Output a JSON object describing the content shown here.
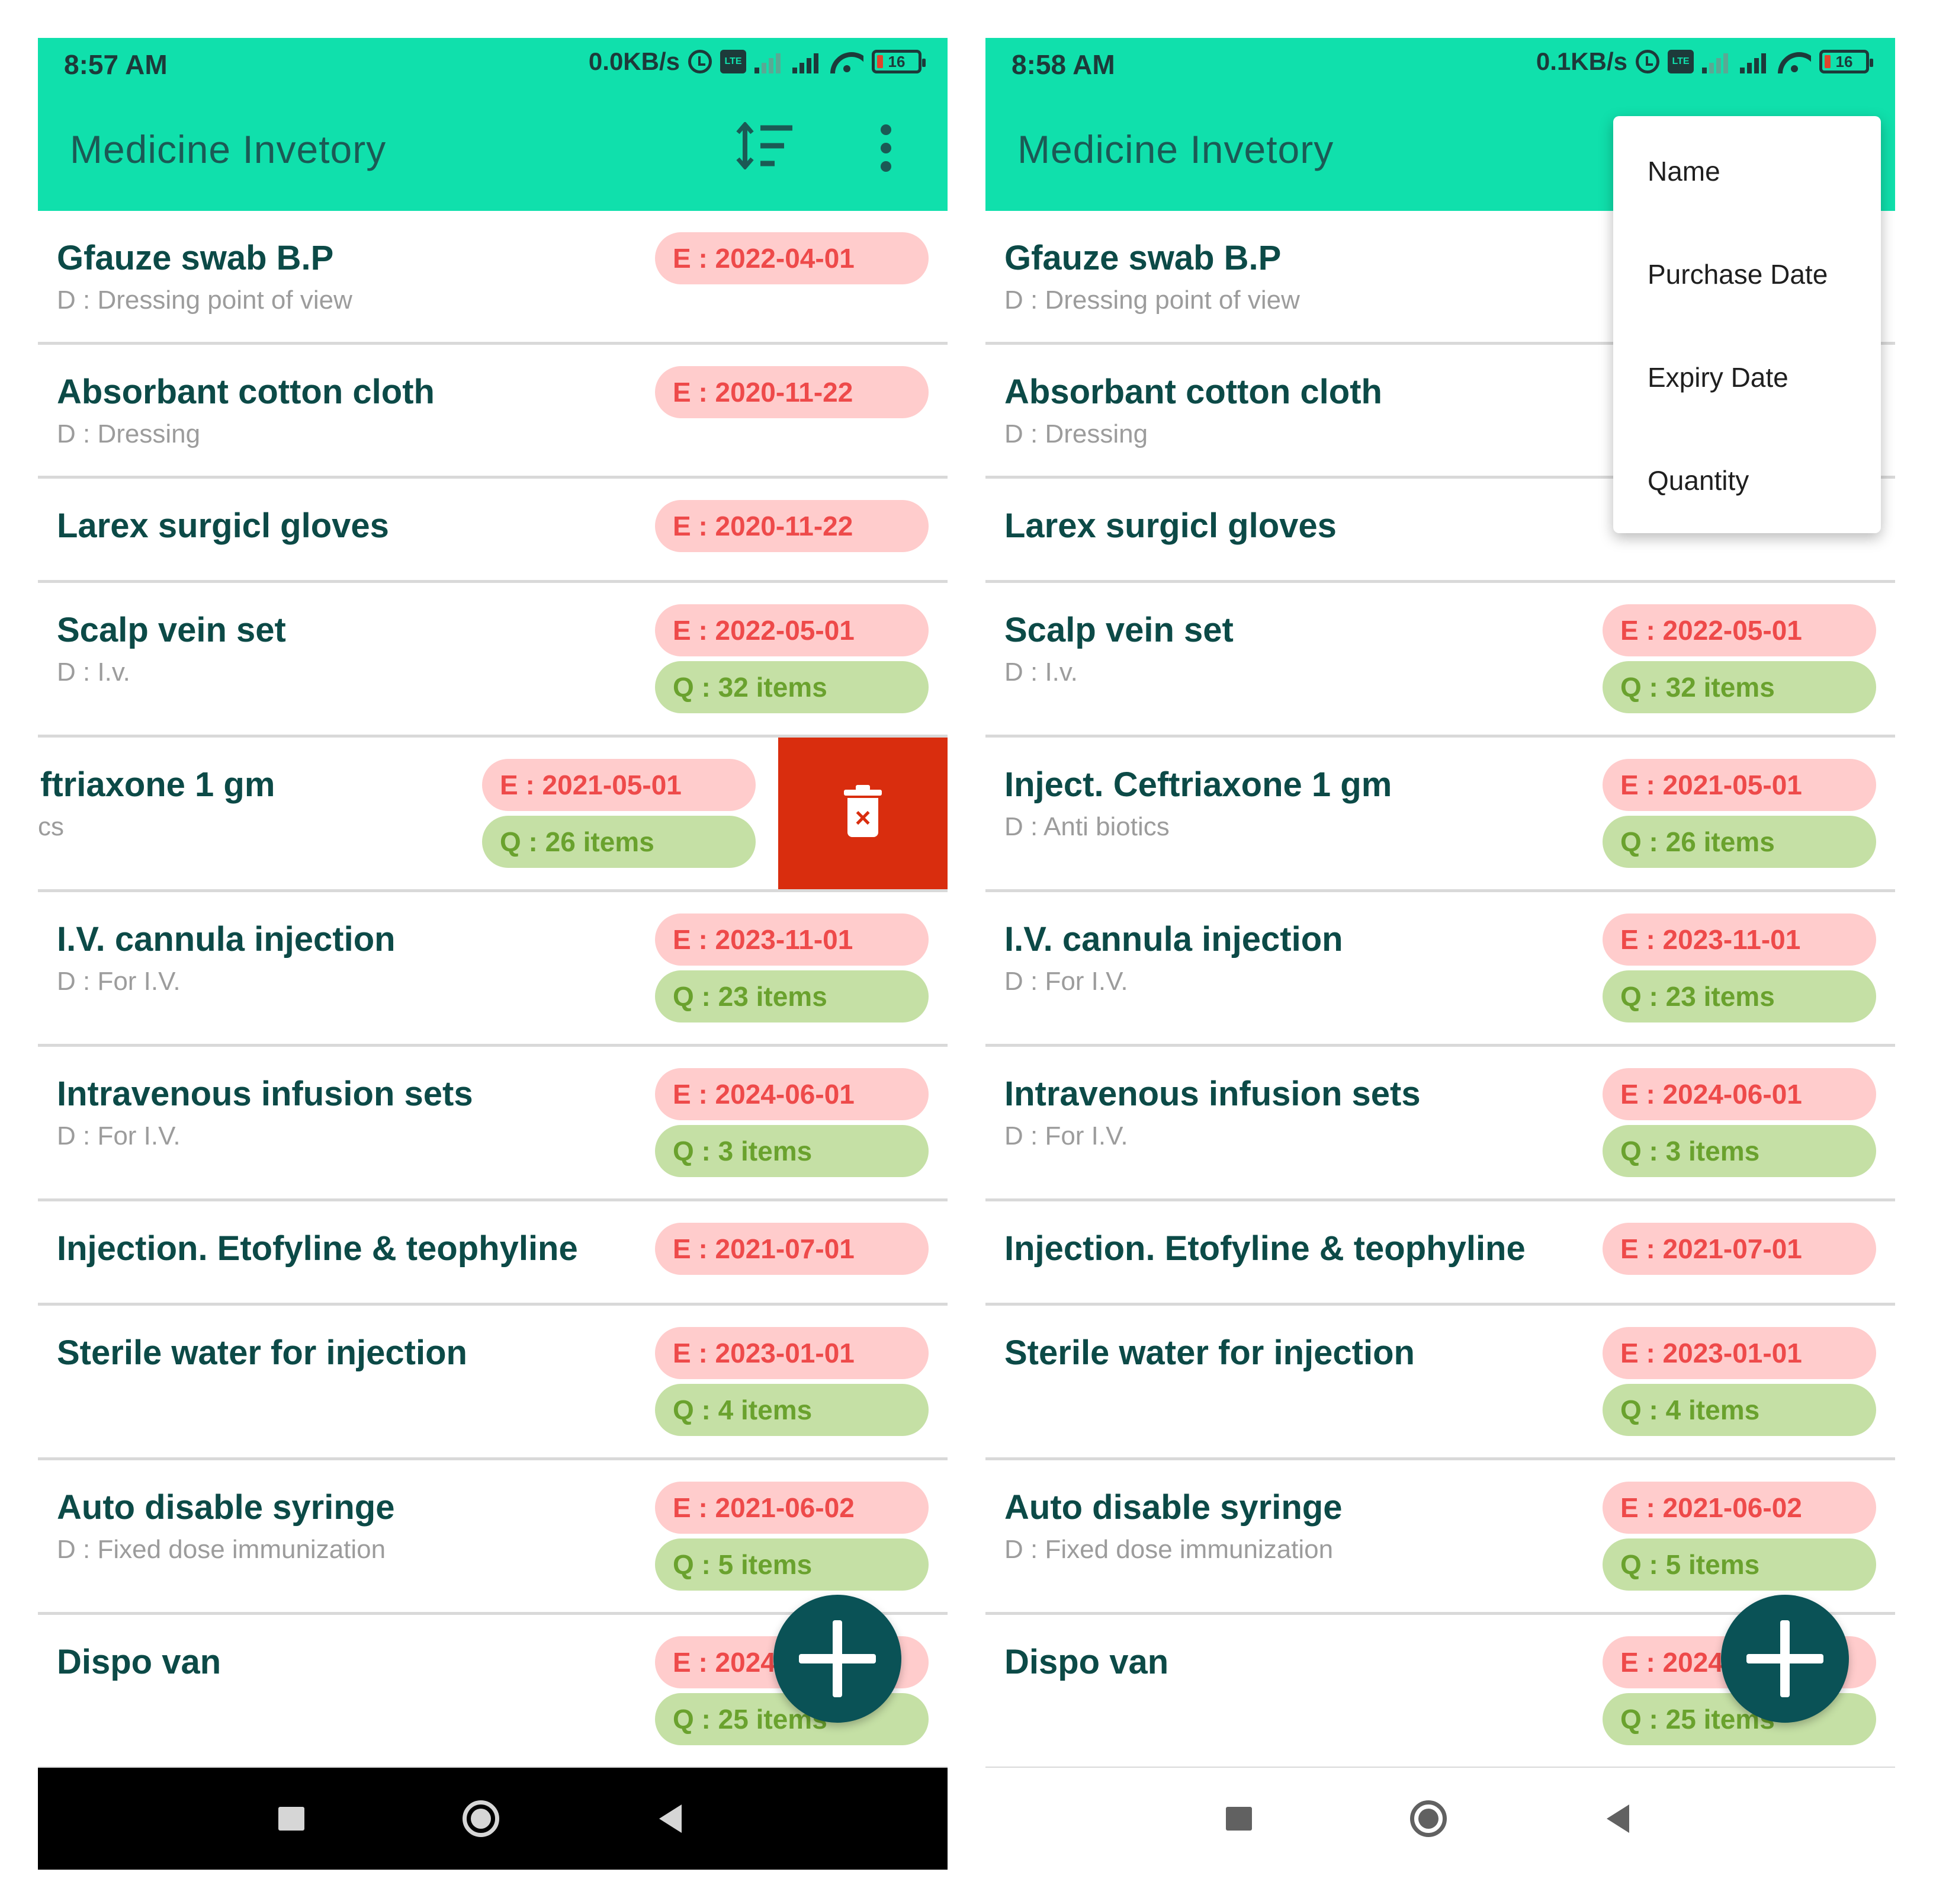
{
  "screens": {
    "left": {
      "status": {
        "time": "8:57 AM",
        "net_speed": "0.0KB/s",
        "battery_level": "16"
      },
      "appbar": {
        "title": "Medicine Invetory",
        "sort_icon": "sort-icon",
        "more_icon": "more-vert-icon"
      },
      "items": [
        {
          "name": "Gfauze swab B.P",
          "desc": "D : Dressing point of view",
          "expiry": "E : 2022-04-01",
          "qty": ""
        },
        {
          "name": "Absorbant cotton cloth",
          "desc": "D : Dressing",
          "expiry": "E : 2020-11-22",
          "qty": ""
        },
        {
          "name": "Larex surgicl gloves",
          "desc": "",
          "expiry": "E : 2020-11-22",
          "qty": ""
        },
        {
          "name": "Scalp vein set",
          "desc": "D : I.v.",
          "expiry": "E : 2022-05-01",
          "qty": "Q : 32 items"
        },
        {
          "name": "ftriaxone 1 gm",
          "desc": "cs",
          "expiry": "E : 2021-05-01",
          "qty": "Q : 26 items",
          "delete_icon": "delete-icon"
        },
        {
          "name": "I.V. cannula injection",
          "desc": "D : For I.V.",
          "expiry": "E : 2023-11-01",
          "qty": "Q : 23 items"
        },
        {
          "name": "Intravenous infusion sets",
          "desc": "D : For I.V.",
          "expiry": "E : 2024-06-01",
          "qty": "Q : 3 items"
        },
        {
          "name": "Injection. Etofyline & teophyline",
          "desc": "",
          "expiry": "E : 2021-07-01",
          "qty": ""
        },
        {
          "name": "Sterile water for injection",
          "desc": "",
          "expiry": "E : 2023-01-01",
          "qty": "Q : 4 items"
        },
        {
          "name": "Auto disable syringe",
          "desc": "D : Fixed dose immunization",
          "expiry": "E : 2021-06-02",
          "qty": "Q : 5 items"
        },
        {
          "name": "Dispo van",
          "desc": "",
          "expiry": "E : 2024",
          "qty": "Q : 25 items"
        }
      ],
      "fab_icon": "add-icon",
      "nav": {
        "recents": "recents-icon",
        "home": "home-icon",
        "back": "back-icon"
      }
    },
    "right": {
      "status": {
        "time": "8:58 AM",
        "net_speed": "0.1KB/s",
        "battery_level": "16"
      },
      "appbar": {
        "title": "Medicine Invetory"
      },
      "sort_menu": [
        "Name",
        "Purchase Date",
        "Expiry Date",
        "Quantity"
      ],
      "items": [
        {
          "name": "Gfauze swab B.P",
          "desc": "D : Dressing point of view",
          "expiry": "",
          "qty": ""
        },
        {
          "name": "Absorbant cotton cloth",
          "desc": "D : Dressing",
          "expiry": "",
          "qty": ""
        },
        {
          "name": "Larex surgicl gloves",
          "desc": "",
          "expiry": "",
          "qty": ""
        },
        {
          "name": "Scalp vein set",
          "desc": "D : I.v.",
          "expiry": "E : 2022-05-01",
          "qty": "Q : 32 items"
        },
        {
          "name": "Inject. Ceftriaxone 1 gm",
          "desc": "D : Anti biotics",
          "expiry": "E : 2021-05-01",
          "qty": "Q : 26 items"
        },
        {
          "name": "I.V. cannula injection",
          "desc": "D : For I.V.",
          "expiry": "E : 2023-11-01",
          "qty": "Q : 23 items"
        },
        {
          "name": "Intravenous infusion sets",
          "desc": "D : For I.V.",
          "expiry": "E : 2024-06-01",
          "qty": "Q : 3 items"
        },
        {
          "name": "Injection. Etofyline & teophyline",
          "desc": "",
          "expiry": "E : 2021-07-01",
          "qty": ""
        },
        {
          "name": "Sterile water for injection",
          "desc": "",
          "expiry": "E : 2023-01-01",
          "qty": "Q : 4 items"
        },
        {
          "name": "Auto disable syringe",
          "desc": "D : Fixed dose immunization",
          "expiry": "E : 2021-06-02",
          "qty": "Q : 5 items"
        },
        {
          "name": "Dispo van",
          "desc": "",
          "expiry": "E : 2024",
          "qty": "Q : 25 items"
        }
      ],
      "fab_icon": "add-icon",
      "nav": {
        "recents": "recents-icon",
        "home": "home-icon",
        "back": "back-icon"
      }
    }
  },
  "colors": {
    "appbar": "#10E0AC",
    "title_text": "#1b5a55",
    "item_name": "#0c4a47",
    "expiry_pill_bg": "#FFCCCC",
    "expiry_pill_text": "#ee4a4a",
    "qty_pill_bg": "#C5E0A5",
    "qty_pill_text": "#6aa22e",
    "delete_bg": "#D92D0E",
    "fab_bg": "#0a5256"
  }
}
